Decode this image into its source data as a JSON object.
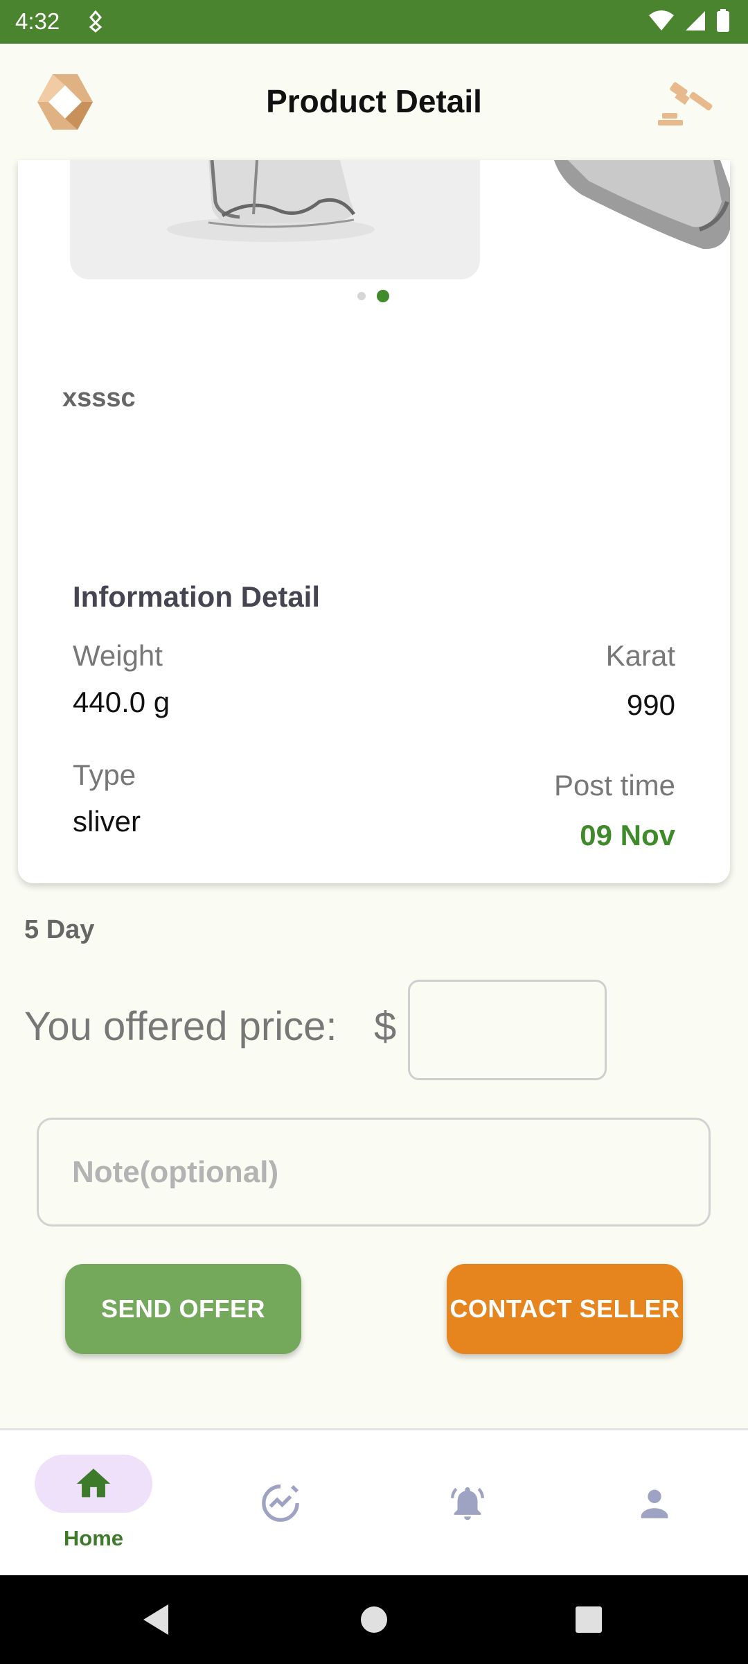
{
  "status_bar": {
    "time": "4:32"
  },
  "app_bar": {
    "title": "Product Detail"
  },
  "product": {
    "name": "xsssc",
    "carousel": {
      "total": 2,
      "active_index": 1
    }
  },
  "info": {
    "heading": "Information Detail",
    "weight_label": "Weight",
    "weight_value": "440.0 g",
    "karat_label": "Karat",
    "karat_value": "990",
    "type_label": "Type",
    "type_value": "sliver",
    "post_time_label": "Post time",
    "post_time_value": "09 Nov"
  },
  "offer": {
    "days_left": "5 Day",
    "price_label": "You offered price:",
    "currency_symbol": "$",
    "price_value": "",
    "note_placeholder": "Note(optional)",
    "send_label": "SEND OFFER",
    "contact_label": "CONTACT SELLER"
  },
  "bottom_nav": {
    "items": [
      {
        "label": "Home",
        "icon": "home-icon",
        "active": true
      },
      {
        "label": "",
        "icon": "market-trend-icon",
        "active": false
      },
      {
        "label": "",
        "icon": "notification-bell-icon",
        "active": false
      },
      {
        "label": "",
        "icon": "profile-icon",
        "active": false
      }
    ]
  },
  "colors": {
    "status_bar": "#4a842e",
    "accent_green": "#3f8a2a",
    "send_button": "#74a95b",
    "contact_button": "#e6851e",
    "nav_pill": "#efe1fa",
    "nav_inactive_icon": "#9ea3c4"
  }
}
